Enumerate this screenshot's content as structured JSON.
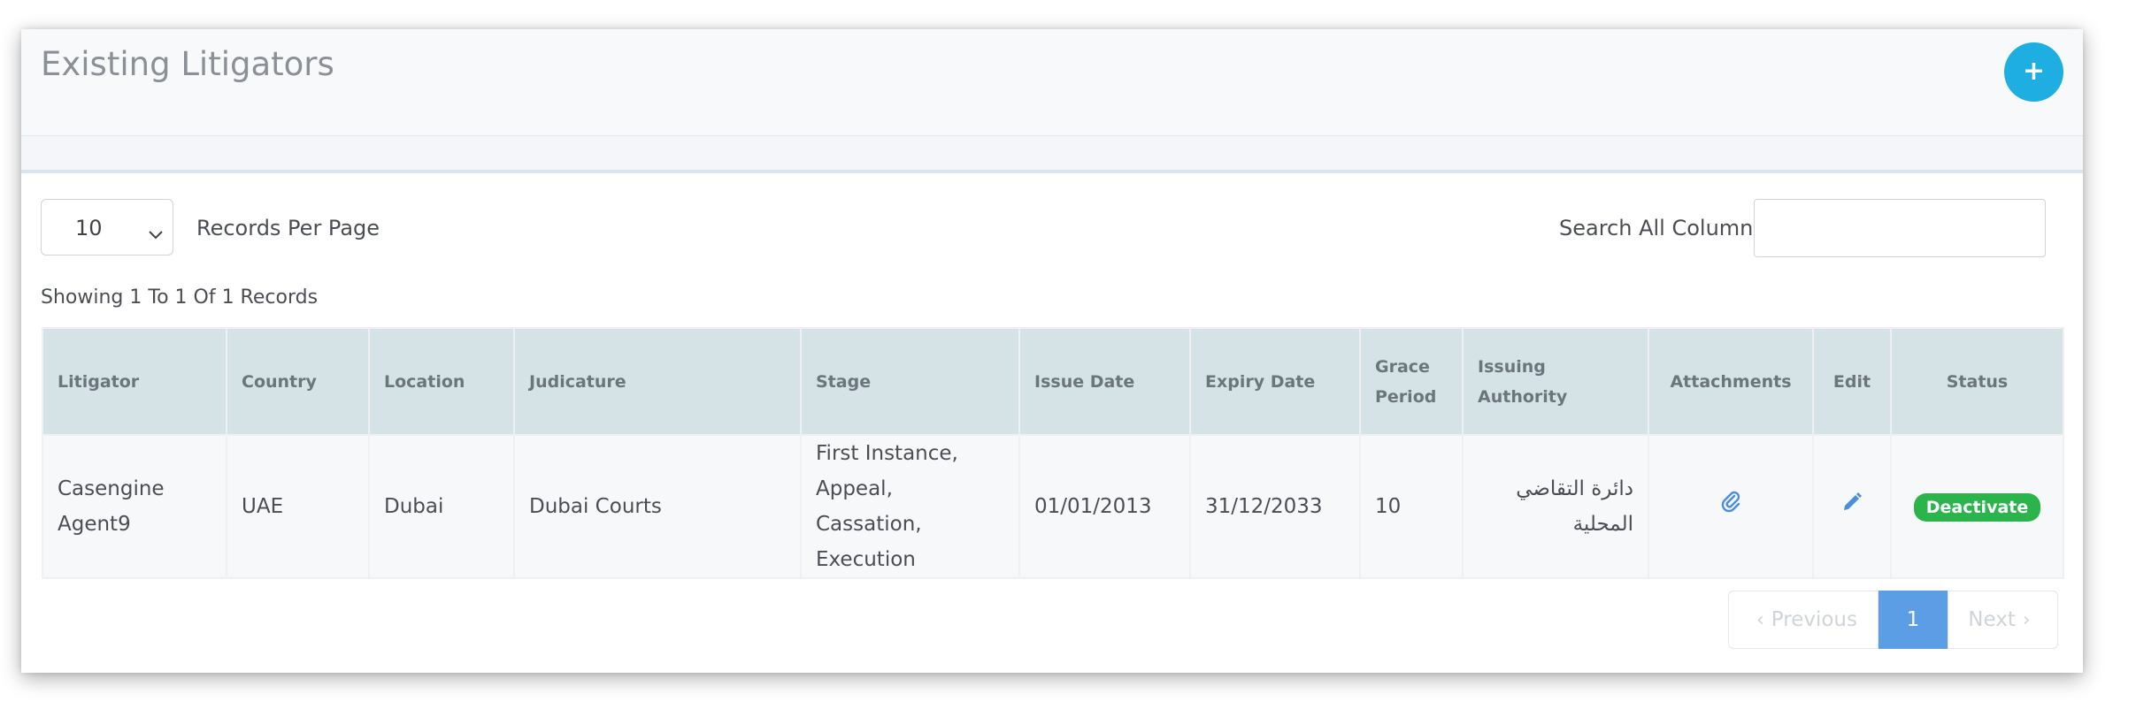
{
  "header": {
    "title": "Existing Litigators",
    "add_button_label": "+"
  },
  "controls": {
    "page_length": "10",
    "page_length_suffix": "Records Per Page",
    "search_label": "Search All Columns",
    "search_value": ""
  },
  "summary": "Showing 1 To 1 Of 1 Records",
  "table": {
    "columns": {
      "litigator": "Litigator",
      "country": "Country",
      "location": "Location",
      "judicature": "Judicature",
      "stage": "Stage",
      "issue_date": "Issue Date",
      "expiry_date": "Expiry Date",
      "grace_period": "Grace Period",
      "issuing_authority": "Issuing Authority",
      "attachments": "Attachments",
      "edit": "Edit",
      "status": "Status"
    },
    "rows": [
      {
        "litigator": "Casengine Agent9",
        "country": "UAE",
        "location": "Dubai",
        "judicature": "Dubai Courts",
        "stage": "First Instance, Appeal, Cassation, Execution",
        "issue_date": "01/01/2013",
        "expiry_date": "31/12/2033",
        "grace_period": "10",
        "issuing_authority": "دائرة التقاضي المحلية",
        "attachments_icon": "paperclip-icon",
        "edit_icon": "pencil-icon",
        "status_button": "Deactivate"
      }
    ]
  },
  "pagination": {
    "previous": "Previous",
    "current": "1",
    "next": "Next"
  },
  "colors": {
    "accent": "#1eaee2",
    "table_header": "#d5e3e6",
    "active_page": "#5b9ee6",
    "status_green": "#2bb44c",
    "icon_blue": "#4a8fdc"
  }
}
